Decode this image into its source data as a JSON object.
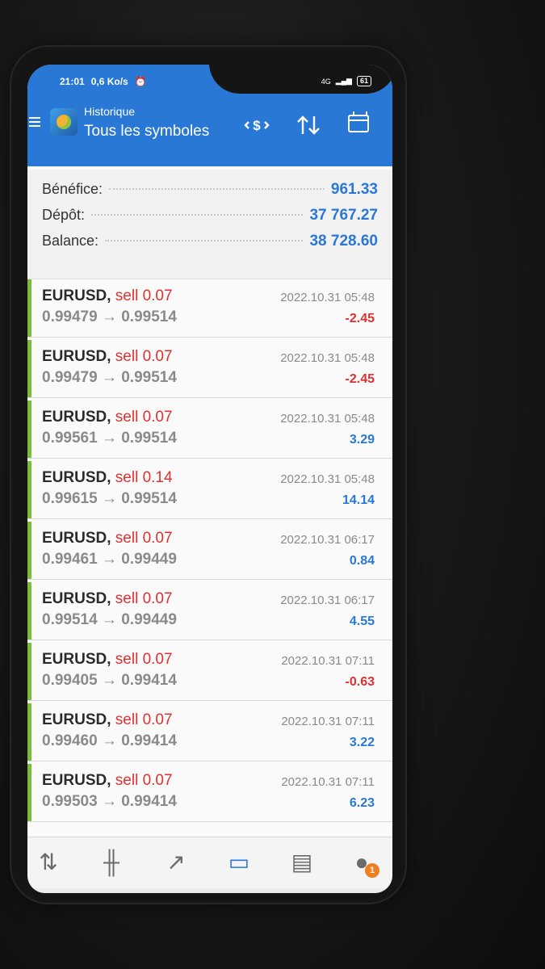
{
  "status": {
    "time": "21:01",
    "speed": "0,6 Ko/s",
    "network": "4G",
    "battery": "61"
  },
  "header": {
    "subtitle": "Historique",
    "title": "Tous les symboles"
  },
  "summary": {
    "profit_label": "Bénéfice:",
    "profit_value": "961.33",
    "deposit_label": "Dépôt:",
    "deposit_value": "37 767.27",
    "balance_label": "Balance:",
    "balance_value": "38 728.60"
  },
  "trades": [
    {
      "symbol": "EURUSD,",
      "side": "sell 0.07",
      "prices": "0.99479 → 0.99514",
      "date": "2022.10.31 05:48",
      "profit": "-2.45"
    },
    {
      "symbol": "EURUSD,",
      "side": "sell 0.07",
      "prices": "0.99479 → 0.99514",
      "date": "2022.10.31 05:48",
      "profit": "-2.45"
    },
    {
      "symbol": "EURUSD,",
      "side": "sell 0.07",
      "prices": "0.99561 → 0.99514",
      "date": "2022.10.31 05:48",
      "profit": "3.29"
    },
    {
      "symbol": "EURUSD,",
      "side": "sell 0.14",
      "prices": "0.99615 → 0.99514",
      "date": "2022.10.31 05:48",
      "profit": "14.14"
    },
    {
      "symbol": "EURUSD,",
      "side": "sell 0.07",
      "prices": "0.99461 → 0.99449",
      "date": "2022.10.31 06:17",
      "profit": "0.84"
    },
    {
      "symbol": "EURUSD,",
      "side": "sell 0.07",
      "prices": "0.99514 → 0.99449",
      "date": "2022.10.31 06:17",
      "profit": "4.55"
    },
    {
      "symbol": "EURUSD,",
      "side": "sell 0.07",
      "prices": "0.99405 → 0.99414",
      "date": "2022.10.31 07:11",
      "profit": "-0.63"
    },
    {
      "symbol": "EURUSD,",
      "side": "sell 0.07",
      "prices": "0.99460 → 0.99414",
      "date": "2022.10.31 07:11",
      "profit": "3.22"
    },
    {
      "symbol": "EURUSD,",
      "side": "sell 0.07",
      "prices": "0.99503 → 0.99414",
      "date": "2022.10.31 07:11",
      "profit": "6.23"
    }
  ],
  "bottom_nav": {
    "items": [
      {
        "icon": "quotes-icon",
        "glyph": "⇅"
      },
      {
        "icon": "chart-icon",
        "glyph": "╫"
      },
      {
        "icon": "trade-icon",
        "glyph": "↗"
      },
      {
        "icon": "history-icon",
        "glyph": "▭"
      },
      {
        "icon": "news-icon",
        "glyph": "▤"
      },
      {
        "icon": "chat-icon",
        "glyph": "●"
      }
    ],
    "chat_badge": "1"
  },
  "colors": {
    "accent": "#2a78d6",
    "loss": "#e03030",
    "sell_bar": "#7dbb3c"
  }
}
